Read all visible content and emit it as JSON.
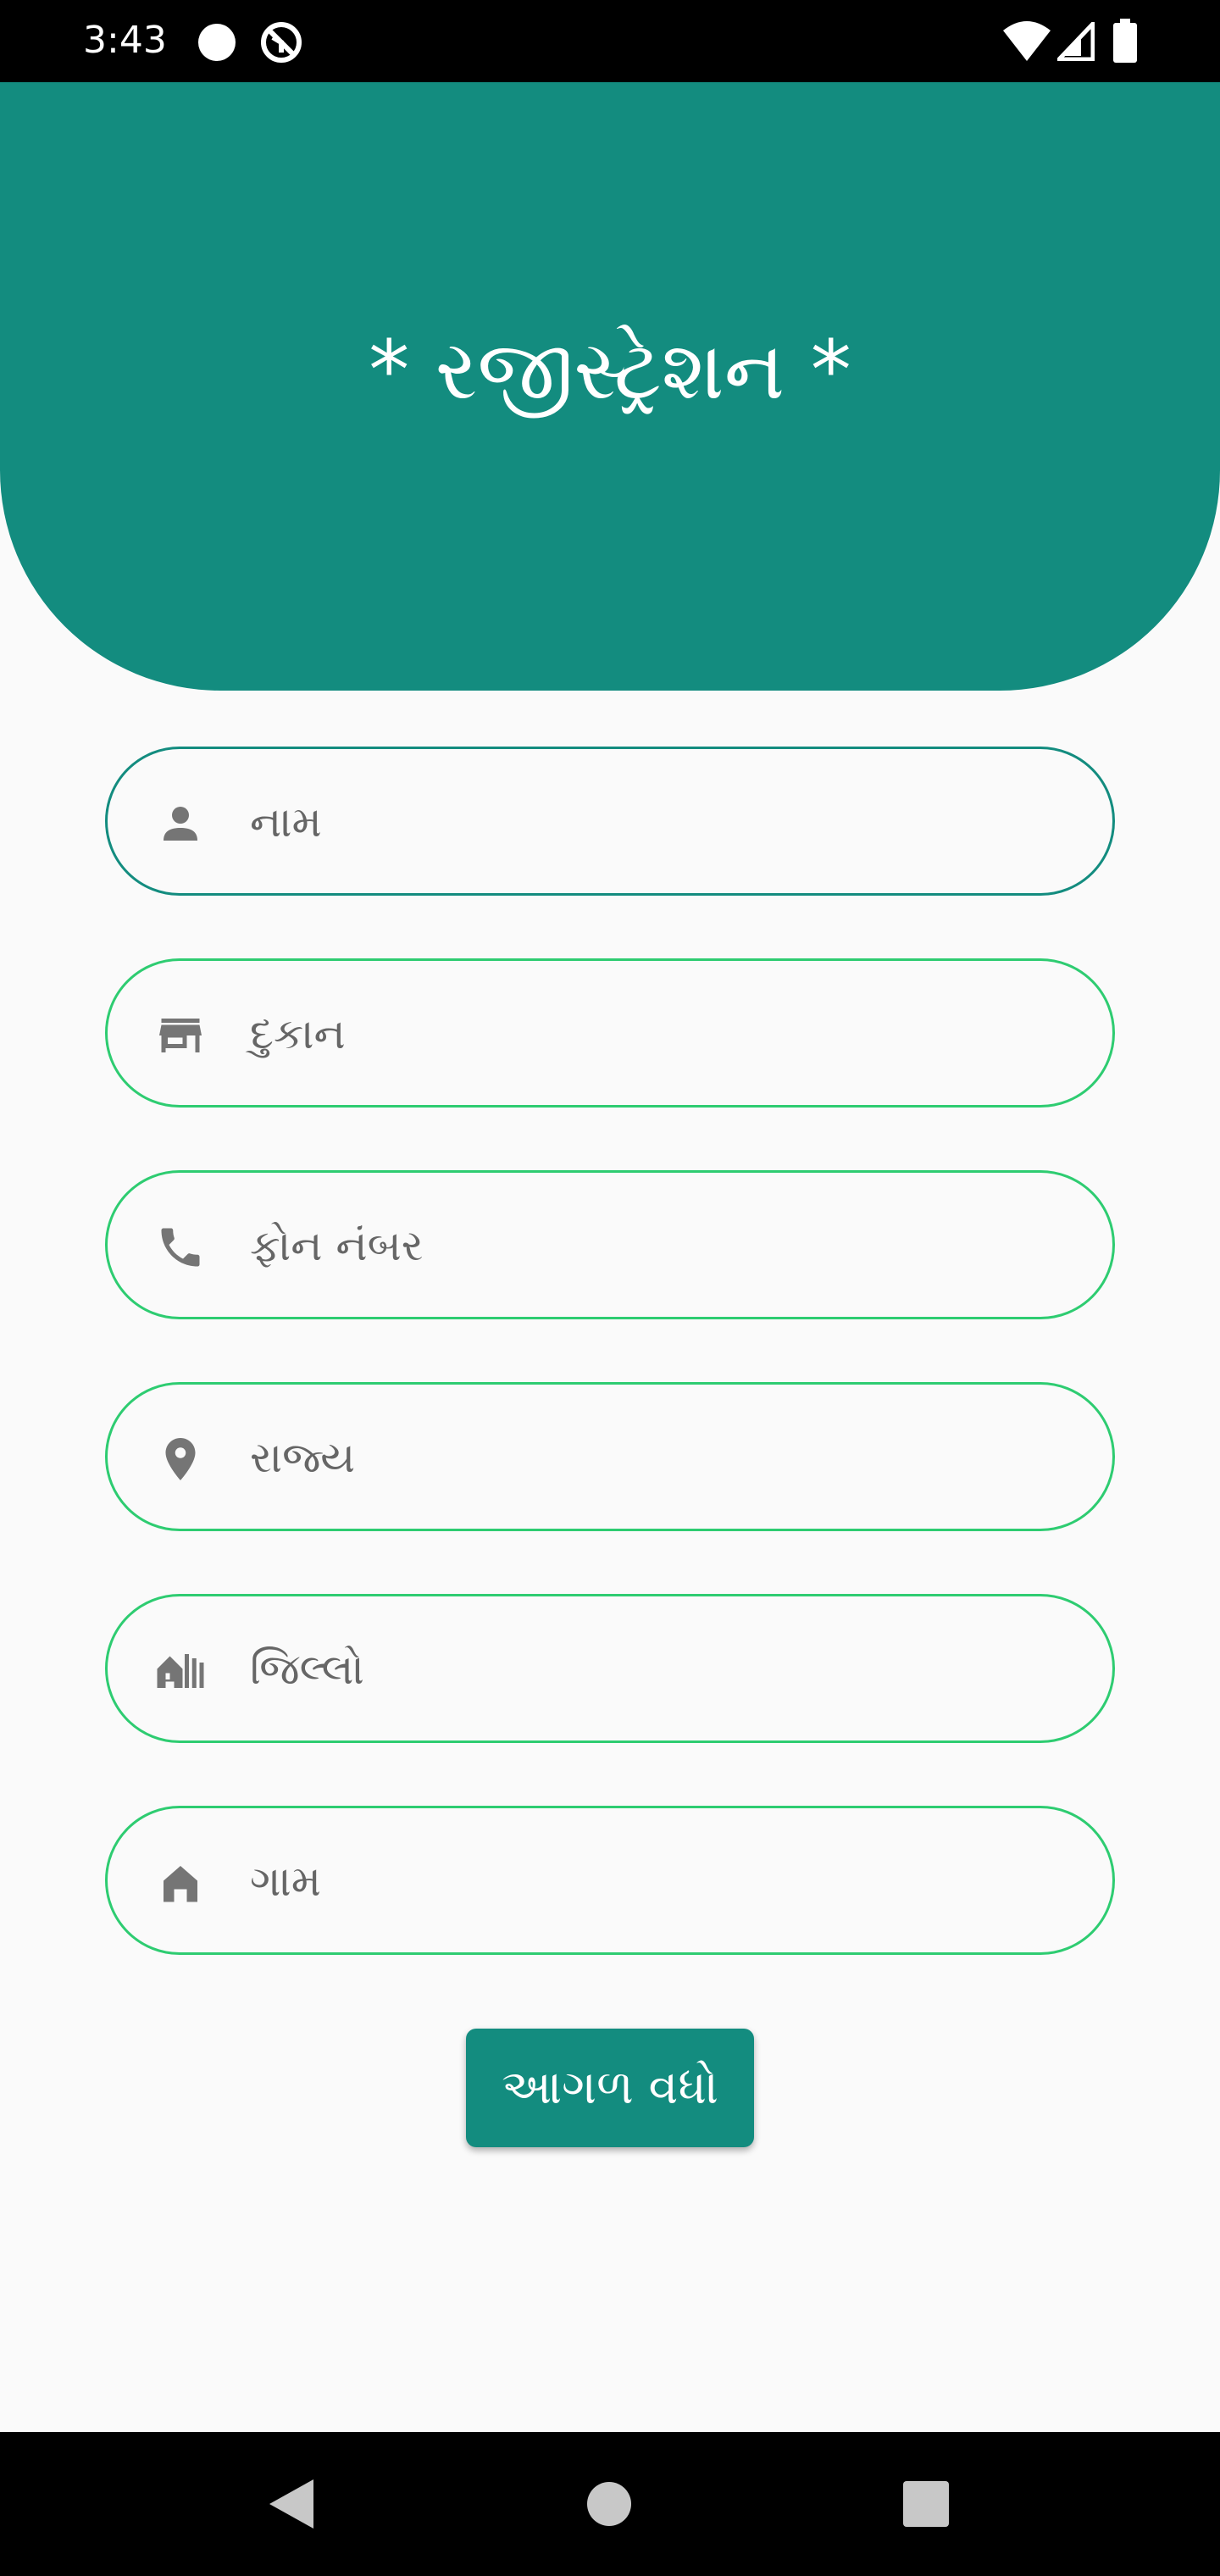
{
  "status_bar": {
    "time": "3:43"
  },
  "header": {
    "title": "* રજીસ્ટ્રેશન *",
    "color": "#138C7F"
  },
  "form": {
    "fields": [
      {
        "label": "નામ",
        "icon": "person-icon"
      },
      {
        "label": "દુકાન",
        "icon": "store-icon"
      },
      {
        "label": "ફોન નંબર",
        "icon": "phone-icon"
      },
      {
        "label": "રાજ્ય",
        "icon": "location-pin-icon"
      },
      {
        "label": "જિલ્લો",
        "icon": "city-icon"
      },
      {
        "label": "ગામ",
        "icon": "home-icon"
      }
    ],
    "submit_label": "આગળ વધો"
  },
  "colors": {
    "accent": "#138C7F",
    "field_border": "#2ECC71",
    "focused_border": "#138C7F",
    "icon": "#757575"
  }
}
